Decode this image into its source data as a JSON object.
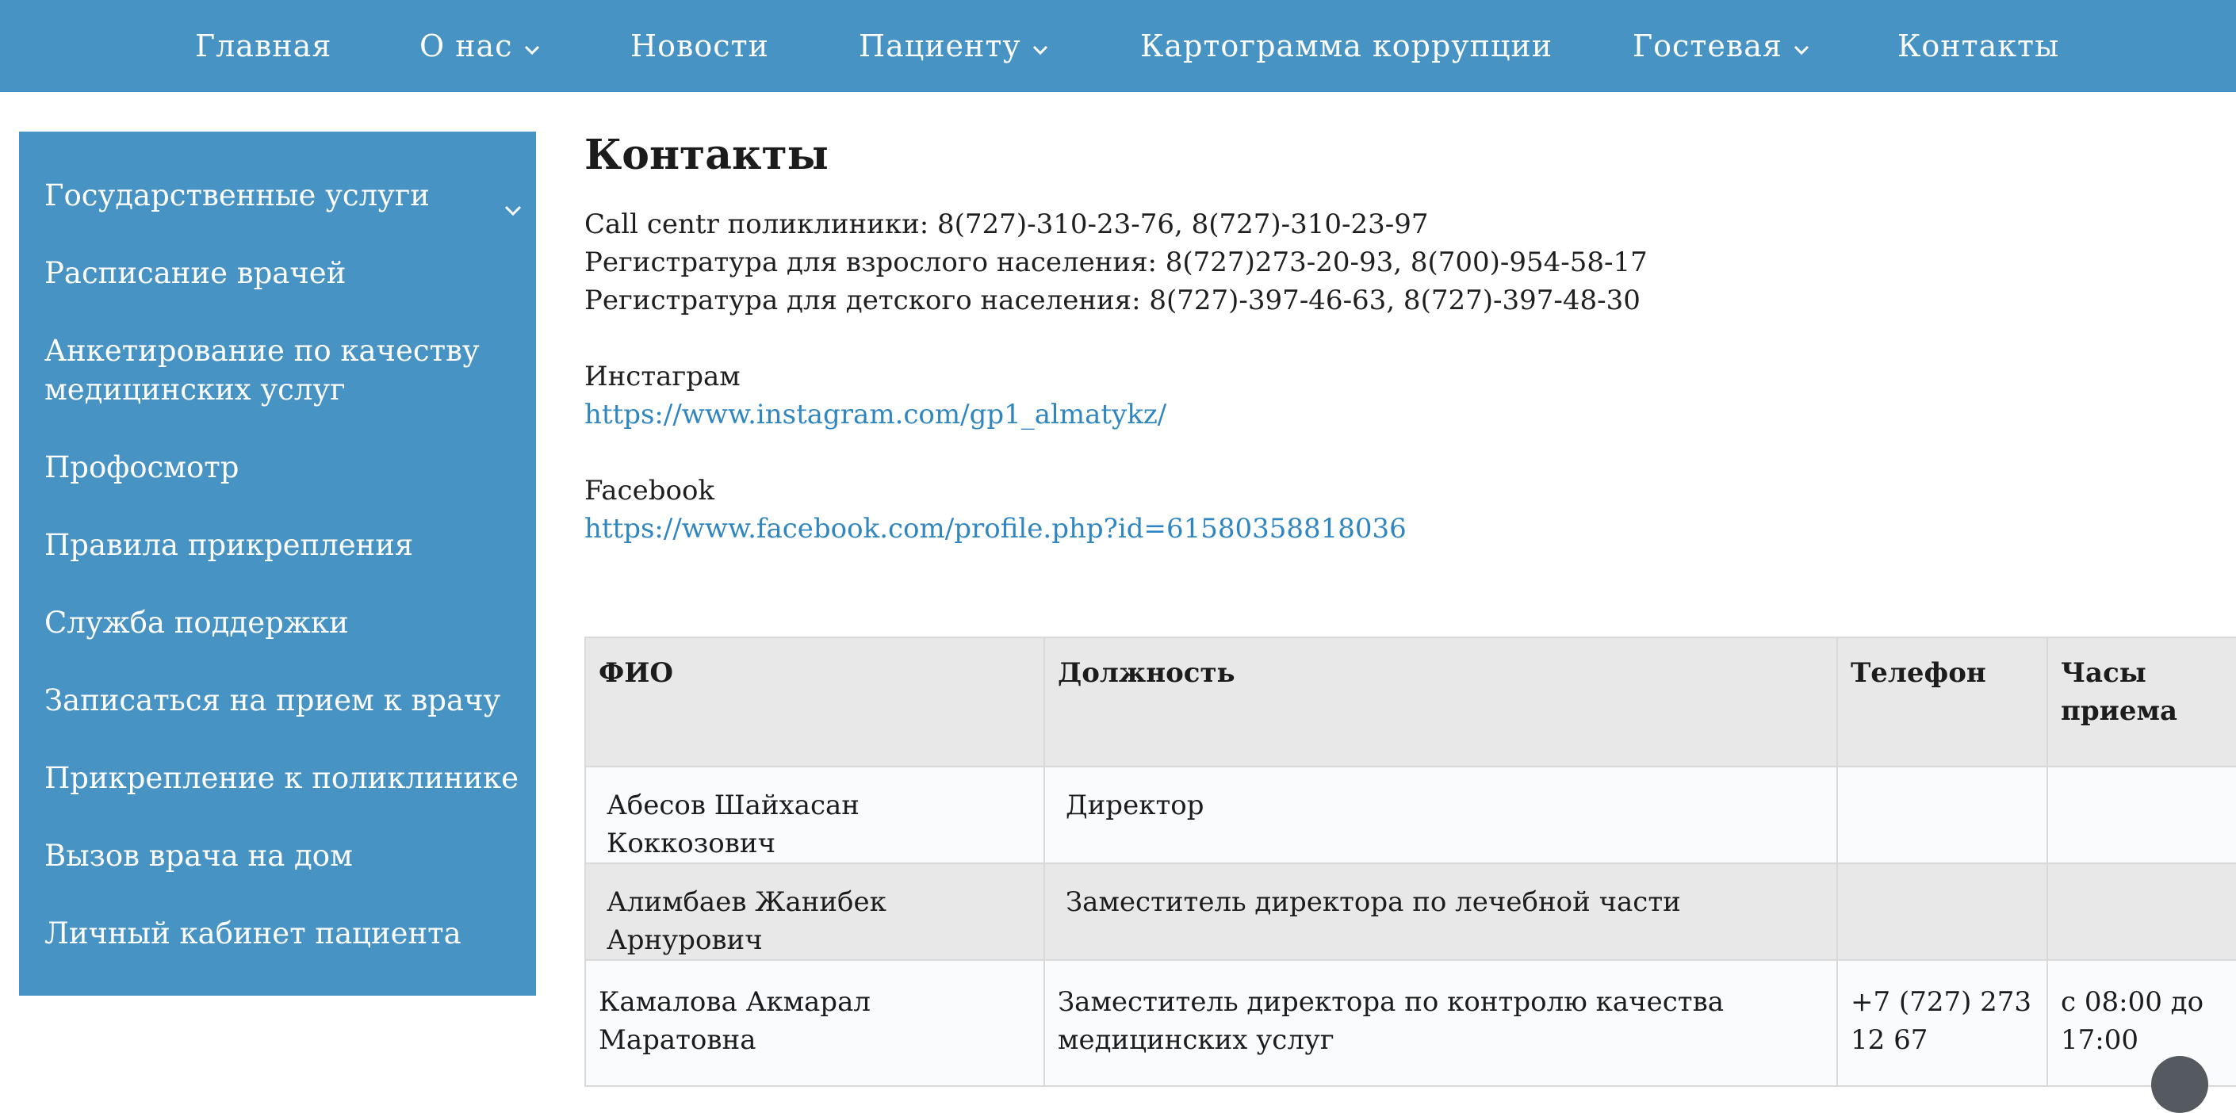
{
  "colors": {
    "brand_blue": "#4793c4",
    "link_blue": "#2f86c0",
    "table_header_bg": "#e8e8e8",
    "row_light_bg": "#fafbfd"
  },
  "nav": {
    "items": [
      {
        "label": "Главная",
        "has_dropdown": false
      },
      {
        "label": "О нас",
        "has_dropdown": true,
        "icon": "chevron-down-icon"
      },
      {
        "label": "Новости",
        "has_dropdown": false
      },
      {
        "label": "Пациенту",
        "has_dropdown": true,
        "icon": "chevron-down-icon"
      },
      {
        "label": "Картограмма коррупции",
        "has_dropdown": false
      },
      {
        "label": "Гостевая",
        "has_dropdown": true,
        "icon": "chevron-down-icon"
      },
      {
        "label": "Контакты",
        "has_dropdown": false
      }
    ]
  },
  "sidebar": {
    "items": [
      {
        "label": "Государственные услуги",
        "icon": "chevron-down-icon"
      },
      {
        "label": "Расписание врачей"
      },
      {
        "label": "Анкетирование по качеству медицинских услуг"
      },
      {
        "label": "Профосмотр"
      },
      {
        "label": "Правила прикрепления"
      },
      {
        "label": "Служба поддержки"
      },
      {
        "label": "Записаться на прием к врачу"
      },
      {
        "label": "Прикрепление к поликлинике"
      },
      {
        "label": "Вызов врача на дом"
      },
      {
        "label": "Личный кабинет пациента"
      }
    ]
  },
  "main": {
    "title": "Контакты",
    "phones": [
      "Call centr поликлиники: 8(727)-310-23-76, 8(727)-310-23-97",
      "Регистратура для взрослого населения: 8(727)273-20-93, 8(700)-954-58-17",
      "Регистратура для детского населения: 8(727)-397-46-63, 8(727)-397-48-30"
    ],
    "instagram": {
      "label": "Инстаграм",
      "url": "https://www.instagram.com/gp1_almatykz/"
    },
    "facebook": {
      "label": "Facebook",
      "url": "https://www.facebook.com/profile.php?id=61580358818036"
    }
  },
  "table": {
    "headers": [
      "ФИО",
      "Должность",
      "Телефон",
      "Часы приема"
    ],
    "rows": [
      {
        "name": "Абесов Шайхасан Коккозович",
        "position": "Директор",
        "phone": "",
        "hours": ""
      },
      {
        "name": "Алимбаев Жанибек Арнурович",
        "position": "Заместитель директора по лечебной части",
        "phone": "",
        "hours": ""
      },
      {
        "name": "Камалова Акмарал Маратовна",
        "position": "Заместитель директора по контролю качества медицинских услуг",
        "phone": "+7 (727) 273 12 67",
        "hours": "с 08:00 до 17:00"
      }
    ]
  },
  "scroll_top": {
    "icon": "arrow-up-icon"
  }
}
